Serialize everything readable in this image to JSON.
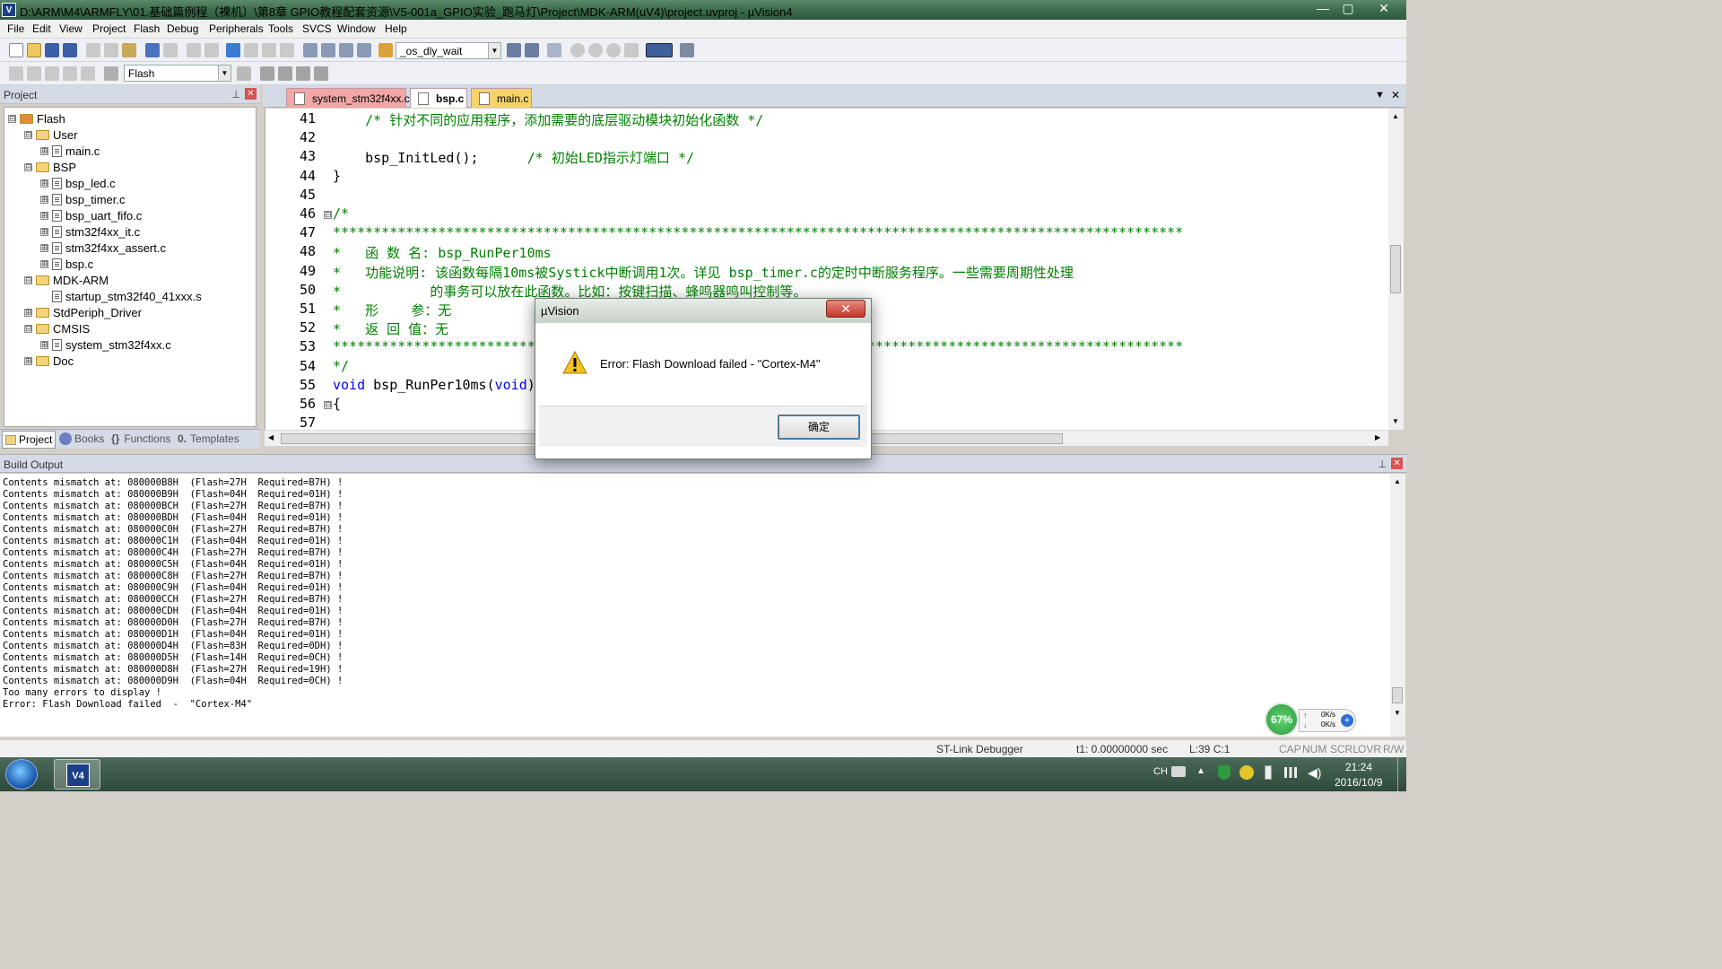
{
  "window": {
    "title": "D:\\ARM\\M4\\ARMFLY\\01.基础篇例程（裸机）\\第8章 GPIO教程配套资源\\V5-001a_GPIO实验_跑马灯\\Project\\MDK-ARM(uV4)\\project.uvproj - µVision4",
    "app_icon": "V",
    "buttons": {
      "minimize": "—",
      "maximize": "▢",
      "close": "✕"
    }
  },
  "menu": [
    "File",
    "Edit",
    "View",
    "Project",
    "Flash",
    "Debug",
    "Peripherals",
    "Tools",
    "SVCS",
    "Window",
    "Help"
  ],
  "toolbar": {
    "find_combo": "_os_dly_wait",
    "target_combo": "Flash"
  },
  "project_panel": {
    "title": "Project",
    "tree": [
      {
        "label": "Flash",
        "level": 0,
        "type": "root",
        "toggle": "⊟"
      },
      {
        "label": "User",
        "level": 1,
        "type": "folder",
        "toggle": "⊟"
      },
      {
        "label": "main.c",
        "level": 2,
        "type": "file",
        "toggle": "⊞"
      },
      {
        "label": "BSP",
        "level": 1,
        "type": "folder",
        "toggle": "⊟"
      },
      {
        "label": "bsp_led.c",
        "level": 2,
        "type": "file",
        "toggle": "⊞"
      },
      {
        "label": "bsp_timer.c",
        "level": 2,
        "type": "file",
        "toggle": "⊞"
      },
      {
        "label": "bsp_uart_fifo.c",
        "level": 2,
        "type": "file",
        "toggle": "⊞"
      },
      {
        "label": "stm32f4xx_it.c",
        "level": 2,
        "type": "file",
        "toggle": "⊞"
      },
      {
        "label": "stm32f4xx_assert.c",
        "level": 2,
        "type": "file",
        "toggle": "⊞"
      },
      {
        "label": "bsp.c",
        "level": 2,
        "type": "file",
        "toggle": "⊞"
      },
      {
        "label": "MDK-ARM",
        "level": 1,
        "type": "folder",
        "toggle": "⊟"
      },
      {
        "label": "startup_stm32f40_41xxx.s",
        "level": 2,
        "type": "file",
        "toggle": ""
      },
      {
        "label": "StdPeriph_Driver",
        "level": 1,
        "type": "folder",
        "toggle": "⊞"
      },
      {
        "label": "CMSIS",
        "level": 1,
        "type": "folder",
        "toggle": "⊟"
      },
      {
        "label": "system_stm32f4xx.c",
        "level": 2,
        "type": "file",
        "toggle": "⊞"
      },
      {
        "label": "Doc",
        "level": 1,
        "type": "folder",
        "toggle": "⊞"
      }
    ],
    "tabs": [
      "Project",
      "Books",
      "Functions",
      "Templates"
    ]
  },
  "editor": {
    "tabs": [
      {
        "label": "system_stm32f4xx.c",
        "color": "#f2a6a6"
      },
      {
        "label": "bsp.c",
        "color": "#f5e08a",
        "active": true
      },
      {
        "label": "main.c",
        "color": "#f5d36a"
      }
    ],
    "lines": [
      {
        "n": "41",
        "text": "    /* 针对不同的应用程序，添加需要的底层驱动模块初始化函数 */",
        "cls": "cmt"
      },
      {
        "n": "42",
        "text": "",
        "cls": ""
      },
      {
        "n": "43",
        "text": "    bsp_InitLed();",
        "cls": "",
        "tail": "      /* 初始LED指示灯端口 */"
      },
      {
        "n": "44",
        "text": "}",
        "cls": ""
      },
      {
        "n": "45",
        "text": "",
        "cls": ""
      },
      {
        "n": "46",
        "text": "/*",
        "cls": "cmt",
        "fold": "⊟"
      },
      {
        "n": "47",
        "text": "*********************************************************************************************************",
        "cls": "cmt"
      },
      {
        "n": "48",
        "text": "*   函 数 名: bsp_RunPer10ms",
        "cls": "cmt"
      },
      {
        "n": "49",
        "text": "*   功能说明: 该函数每隔10ms被Systick中断调用1次。详见 bsp_timer.c的定时中断服务程序。一些需要周期性处理",
        "cls": "cmt"
      },
      {
        "n": "50",
        "text": "*           的事务可以放在此函数。比如：按键扫描、蜂鸣器鸣叫控制等。",
        "cls": "cmt"
      },
      {
        "n": "51",
        "text": "*   形    参：无",
        "cls": "cmt"
      },
      {
        "n": "52",
        "text": "*   返 回 值：无",
        "cls": "cmt"
      },
      {
        "n": "53",
        "text": "*********************************************************************************************************",
        "cls": "cmt"
      },
      {
        "n": "54",
        "text": "*/",
        "cls": "cmt"
      },
      {
        "n": "55",
        "text": "void bsp_RunPer10ms(void)",
        "cls": "kwline"
      },
      {
        "n": "56",
        "text": "{",
        "cls": "",
        "fold": "⊟"
      },
      {
        "n": "57",
        "text": "",
        "cls": ""
      }
    ]
  },
  "build_output": {
    "title": "Build Output",
    "lines": [
      "Contents mismatch at: 080000B8H  (Flash=27H  Required=B7H) !",
      "Contents mismatch at: 080000B9H  (Flash=04H  Required=01H) !",
      "Contents mismatch at: 080000BCH  (Flash=27H  Required=B7H) !",
      "Contents mismatch at: 080000BDH  (Flash=04H  Required=01H) !",
      "Contents mismatch at: 080000C0H  (Flash=27H  Required=B7H) !",
      "Contents mismatch at: 080000C1H  (Flash=04H  Required=01H) !",
      "Contents mismatch at: 080000C4H  (Flash=27H  Required=B7H) !",
      "Contents mismatch at: 080000C5H  (Flash=04H  Required=01H) !",
      "Contents mismatch at: 080000C8H  (Flash=27H  Required=B7H) !",
      "Contents mismatch at: 080000C9H  (Flash=04H  Required=01H) !",
      "Contents mismatch at: 080000CCH  (Flash=27H  Required=B7H) !",
      "Contents mismatch at: 080000CDH  (Flash=04H  Required=01H) !",
      "Contents mismatch at: 080000D0H  (Flash=27H  Required=B7H) !",
      "Contents mismatch at: 080000D1H  (Flash=04H  Required=01H) !",
      "Contents mismatch at: 080000D4H  (Flash=83H  Required=0DH) !",
      "Contents mismatch at: 080000D5H  (Flash=14H  Required=0CH) !",
      "Contents mismatch at: 080000D8H  (Flash=27H  Required=19H) !",
      "Contents mismatch at: 080000D9H  (Flash=04H  Required=0CH) !",
      "Too many errors to display !",
      "Error: Flash Download failed  -  \"Cortex-M4\""
    ]
  },
  "status_bar": {
    "debugger": "ST-Link Debugger",
    "time": "t1: 0.00000000 sec",
    "position": "L:39 C:1",
    "indicators": [
      "CAP",
      "NUM",
      "SCRL",
      "OVR",
      "R/W"
    ]
  },
  "dialog": {
    "title": "µVision",
    "close": "✕",
    "message": "Error: Flash Download failed  -  \"Cortex-M4\"",
    "ok": "确定",
    "icon": "warning-icon"
  },
  "net_widget": {
    "percent": "67%",
    "up": "0K/s",
    "down": "0K/s",
    "plus": "+"
  },
  "taskbar": {
    "lang": "CH",
    "time": "21:24",
    "date": "2016/10/9",
    "app_button": "V4"
  }
}
